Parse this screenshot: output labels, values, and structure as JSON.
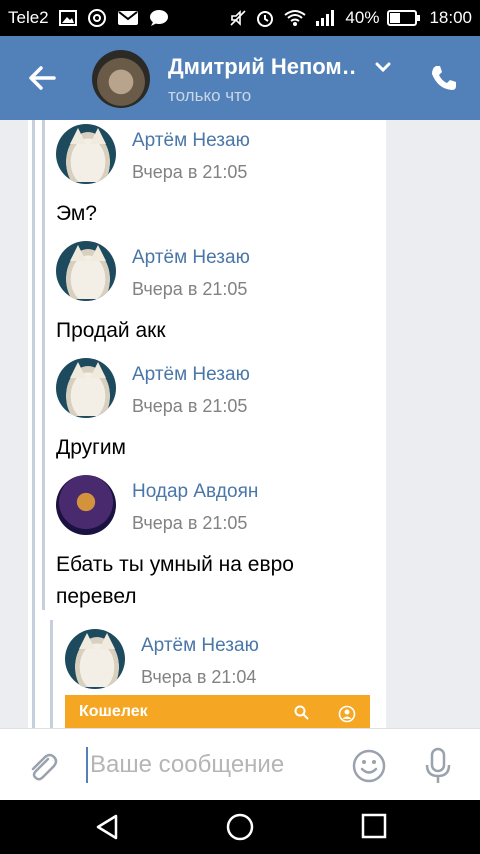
{
  "status_bar": {
    "carrier": "Tele2",
    "battery": "40%",
    "time": "18:00"
  },
  "header": {
    "title": "Дмитрий Непом…",
    "subtitle": "только что"
  },
  "messages": [
    {
      "author": "Артём Незаю",
      "time": "Вчера в 21:05",
      "text": "Эм?"
    },
    {
      "author": "Артём Незаю",
      "time": "Вчера в 21:05",
      "text": "Продай акк"
    },
    {
      "author": "Артём Незаю",
      "time": "Вчера в 21:05",
      "text": "Другим"
    },
    {
      "author": "Нодар Авдоян",
      "time": "Вчера в 21:05",
      "text_line1": "Ебать ты умный на евро",
      "text_line2": "перевел"
    },
    {
      "author": "Артём Незаю",
      "time": "Вчера в 21:04"
    }
  ],
  "wallet_preview": {
    "title": "Кошелек"
  },
  "composer": {
    "placeholder": "Ваше сообщение"
  },
  "colors": {
    "brand": "#5181b8",
    "name": "#4a76a8",
    "wallet": "#f5a623"
  }
}
